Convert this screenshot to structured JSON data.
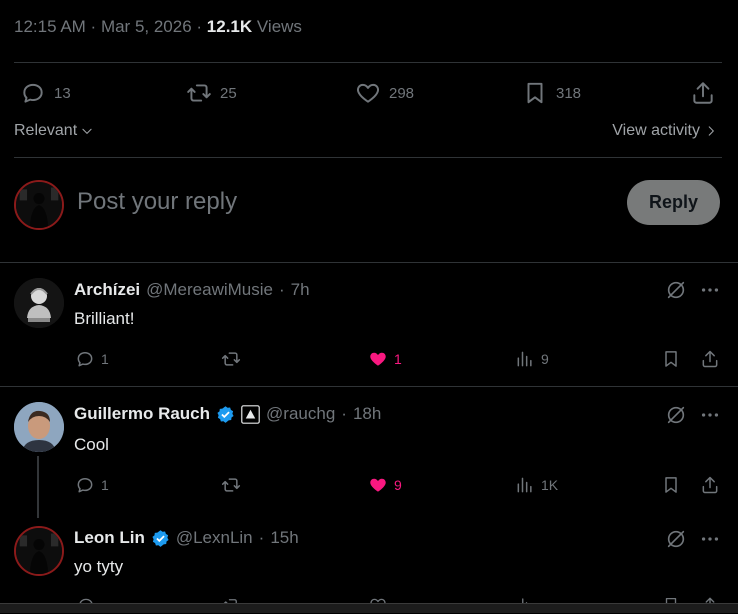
{
  "post_meta": {
    "time": "12:15 AM",
    "date": "Mar 5, 2026",
    "views_count": "12.1K",
    "views_label": "Views"
  },
  "stats": {
    "replies": "13",
    "reposts": "25",
    "likes": "298",
    "bookmarks": "318"
  },
  "sort": {
    "label": "Relevant"
  },
  "view_activity": {
    "label": "View activity"
  },
  "composer": {
    "placeholder": "Post your reply",
    "button": "Reply"
  },
  "replies": [
    {
      "name": "Archízei",
      "handle": "@MereawiMusie",
      "time": "7h",
      "text": "Brilliant!",
      "replies": "1",
      "reposts": "",
      "likes": "1",
      "views": "9"
    },
    {
      "name": "Guillermo Rauch",
      "handle": "@rauchg",
      "time": "18h",
      "text": "Cool",
      "replies": "1",
      "reposts": "",
      "likes": "9",
      "views": "1K"
    },
    {
      "name": "Leon Lin",
      "handle": "@LexnLin",
      "time": "15h",
      "text": "yo tyty"
    }
  ],
  "colors": {
    "accent_like": "#f91880",
    "verified": "#1d9bf0",
    "muted": "#71767b"
  }
}
